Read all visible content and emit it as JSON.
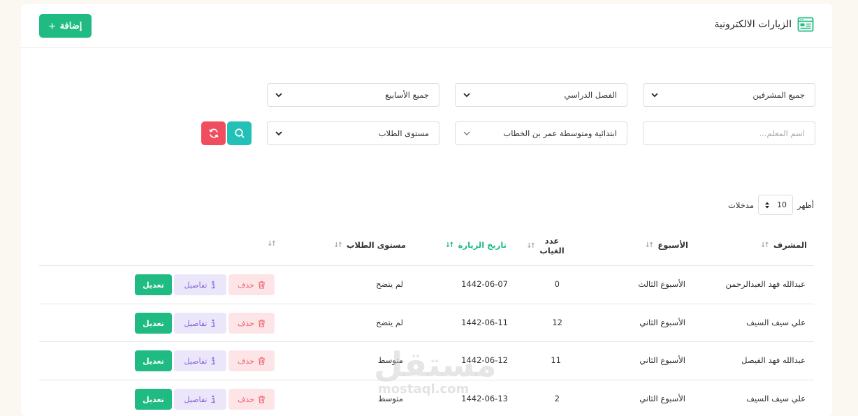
{
  "header": {
    "title": "الزيارات الالكترونية",
    "add_label": "إضافة"
  },
  "filters": {
    "supervisors": "جميع المشرفين",
    "semester": "الفصل الدراسي",
    "weeks": "جميع الأسابيع",
    "teacher_placeholder": "اسم المعلم...",
    "school": "ابتدائية ومتوسطة عمر بن الخطاب",
    "student_level": "مستوى الطلاب"
  },
  "length": {
    "show": "أظهر",
    "value": "10",
    "entries": "مدخلات"
  },
  "table": {
    "columns": {
      "supervisor": "المشرف",
      "week": "الأسبوع",
      "absence": "عدد الغياب",
      "date": "تاريخ الزيارة",
      "level": "مستوى الطلاب"
    },
    "actions": {
      "delete": "حذف",
      "details": "تفاصيل",
      "edit": "تعديل"
    },
    "rows": [
      {
        "supervisor": "عبدالله فهد العبدالرحمن",
        "week": "الأسبوع الثالث",
        "absence": "0",
        "date": "1442-06-07",
        "level": "لم يتضح"
      },
      {
        "supervisor": "علي سيف السيف",
        "week": "الأسبوع الثاني",
        "absence": "12",
        "date": "1442-06-11",
        "level": "لم يتضح"
      },
      {
        "supervisor": "عبدالله فهد الفيصل",
        "week": "الأسبوع الثاني",
        "absence": "11",
        "date": "1442-06-12",
        "level": "متوسط"
      },
      {
        "supervisor": "علي سيف السيف",
        "week": "الأسبوع الثاني",
        "absence": "2",
        "date": "1442-06-13",
        "level": "متوسط"
      }
    ]
  },
  "watermark": {
    "arabic": "مستقل",
    "latin": "mostaql.com"
  },
  "colors": {
    "accent": "#1fbb82",
    "danger": "#f04e5e",
    "info": "#23c0b8",
    "details": "#8b6ad9"
  }
}
